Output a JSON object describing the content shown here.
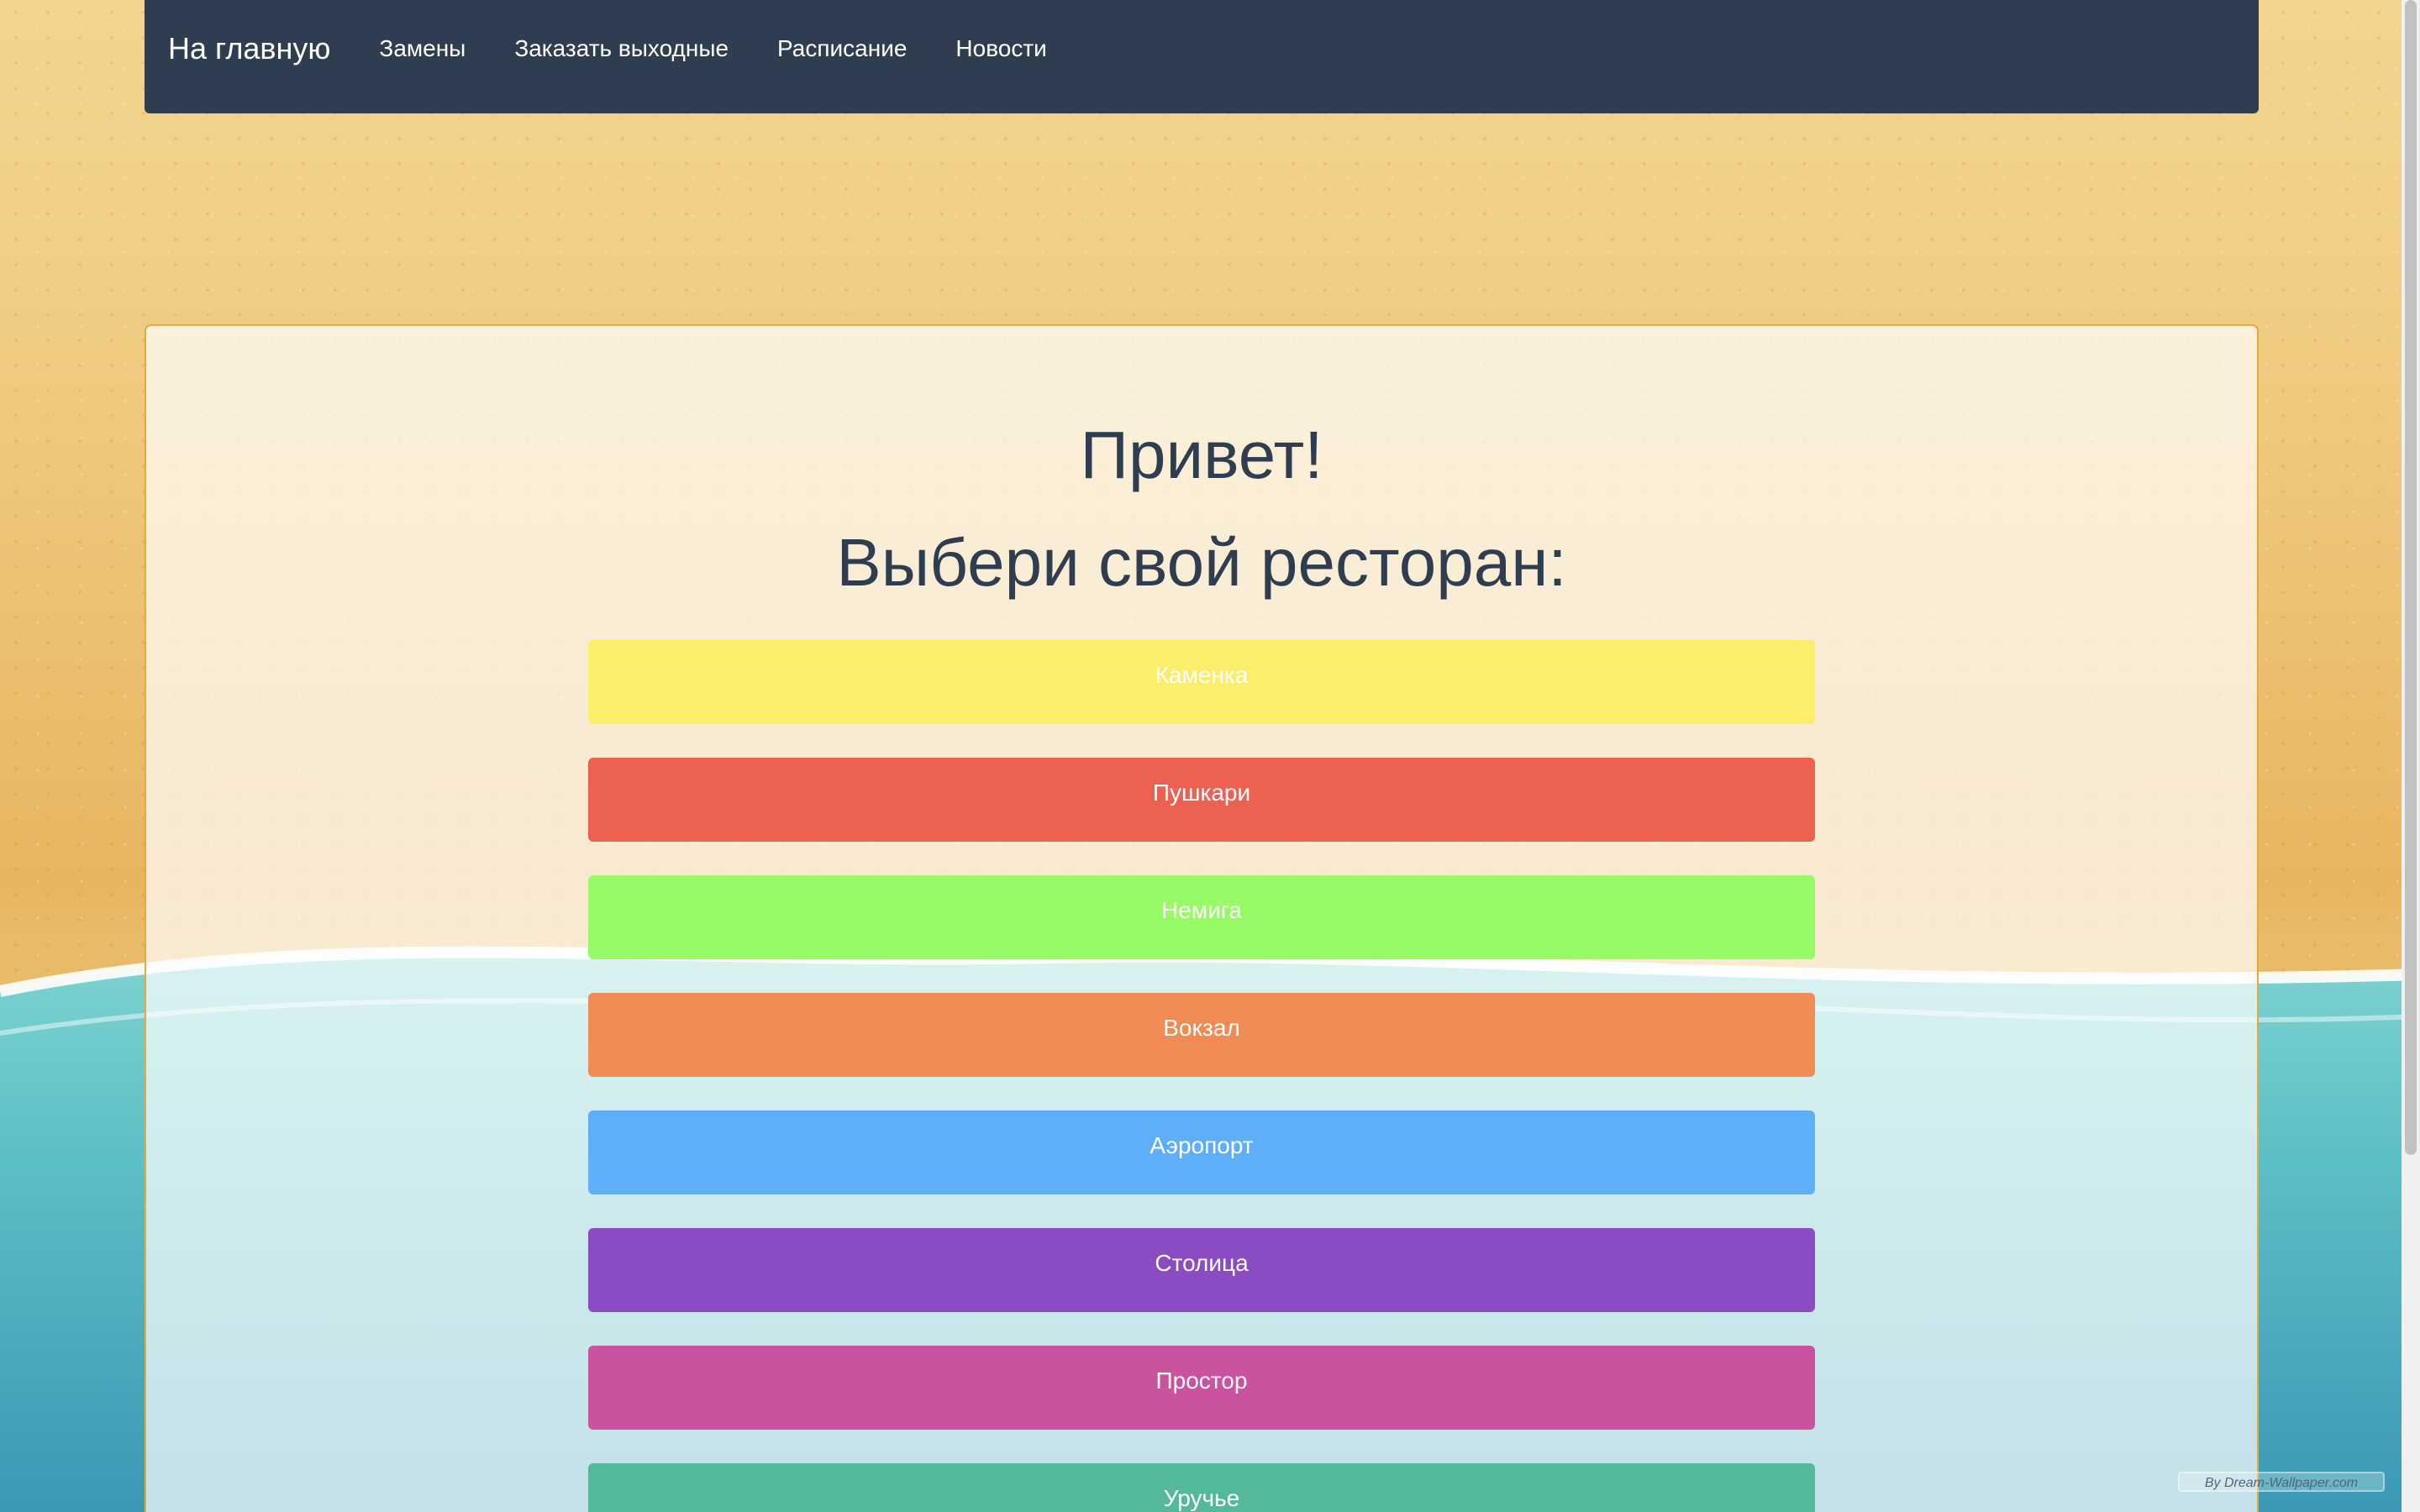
{
  "nav": {
    "brand": "На главную",
    "links": [
      "Замены",
      "Заказать выходные",
      "Расписание",
      "Новости"
    ]
  },
  "main": {
    "title": "Привет!",
    "subtitle": "Выбери свой ресторан:",
    "restaurants": [
      {
        "label": "Каменка",
        "color": "#fcee6a"
      },
      {
        "label": "Пушкари",
        "color": "#ed6152"
      },
      {
        "label": "Немига",
        "color": "#97fb66"
      },
      {
        "label": "Вокзал",
        "color": "#ef8b53"
      },
      {
        "label": "Аэропорт",
        "color": "#5faef8"
      },
      {
        "label": "Столица",
        "color": "#8b4bc3"
      },
      {
        "label": "Простор",
        "color": "#cb529e"
      },
      {
        "label": "Уручье",
        "color": "#54b89c"
      }
    ]
  },
  "watermark": "By Dream-Wallpaper.com",
  "colors": {
    "navbar": "#2e3e50",
    "text_dark": "#2e3e50",
    "card_border": "#e6a93c",
    "sand": "#ecc274",
    "sea": "#5ec0c7"
  }
}
